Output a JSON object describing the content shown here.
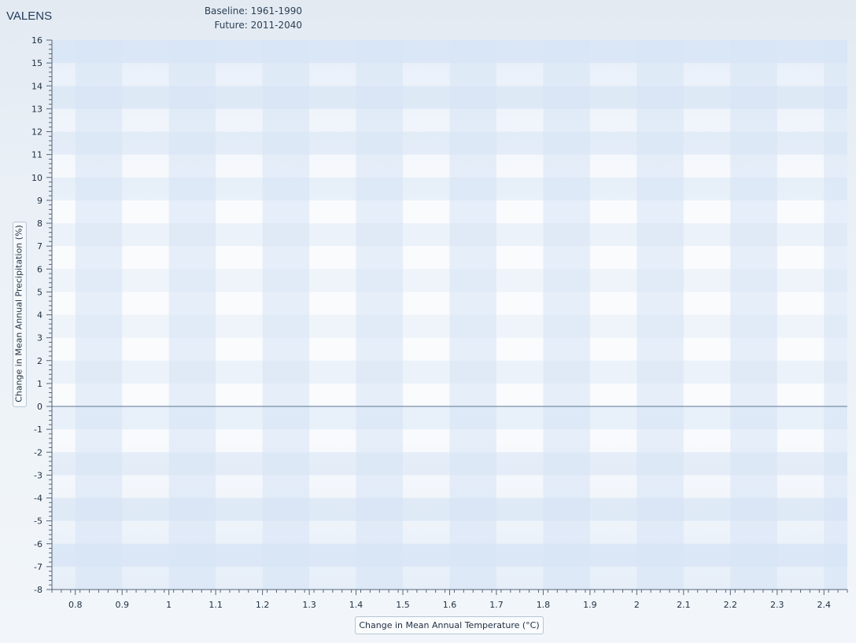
{
  "app": {
    "title": "VALENS"
  },
  "periods": {
    "baseline_label": "Baseline:",
    "baseline_value": "1961-1990",
    "future_label": "Future:",
    "future_value": "2011-2040"
  },
  "colors": {
    "axis": "#55657a",
    "zero_line": "#5d7796",
    "band_dark": "#d6e4f5",
    "band_light": "#eef3fb"
  },
  "chart_data": {
    "type": "scatter",
    "title": "",
    "xlabel": "Change in Mean Annual Temperature (°C)",
    "ylabel": "Change in Mean Annual Precipitation (%)",
    "xlim": [
      0.75,
      2.45
    ],
    "ylim": [
      -8,
      16
    ],
    "x_ticks": [
      0.8,
      0.9,
      1,
      1.1,
      1.2,
      1.3,
      1.4,
      1.5,
      1.6,
      1.7,
      1.8,
      1.9,
      2,
      2.1,
      2.2,
      2.3,
      2.4
    ],
    "x_tick_labels": [
      "0.8",
      "0.9",
      "1",
      "1.1",
      "1.2",
      "1.3",
      "1.4",
      "1.5",
      "1.6",
      "1.7",
      "1.8",
      "1.9",
      "2",
      "2.1",
      "2.2",
      "2.3",
      "2.4"
    ],
    "y_ticks": [
      -8,
      -7,
      -6,
      -5,
      -4,
      -3,
      -2,
      -1,
      0,
      1,
      2,
      3,
      4,
      5,
      6,
      7,
      8,
      9,
      10,
      11,
      12,
      13,
      14,
      15,
      16
    ],
    "y_tick_labels": [
      "-8",
      "-7",
      "-6",
      "-5",
      "-4",
      "-3",
      "-2",
      "-1",
      "0",
      "1",
      "2",
      "3",
      "4",
      "5",
      "6",
      "7",
      "8",
      "9",
      "10",
      "11",
      "12",
      "13",
      "14",
      "15",
      "16"
    ],
    "reference_line_y": 0,
    "grid": true,
    "series": []
  }
}
